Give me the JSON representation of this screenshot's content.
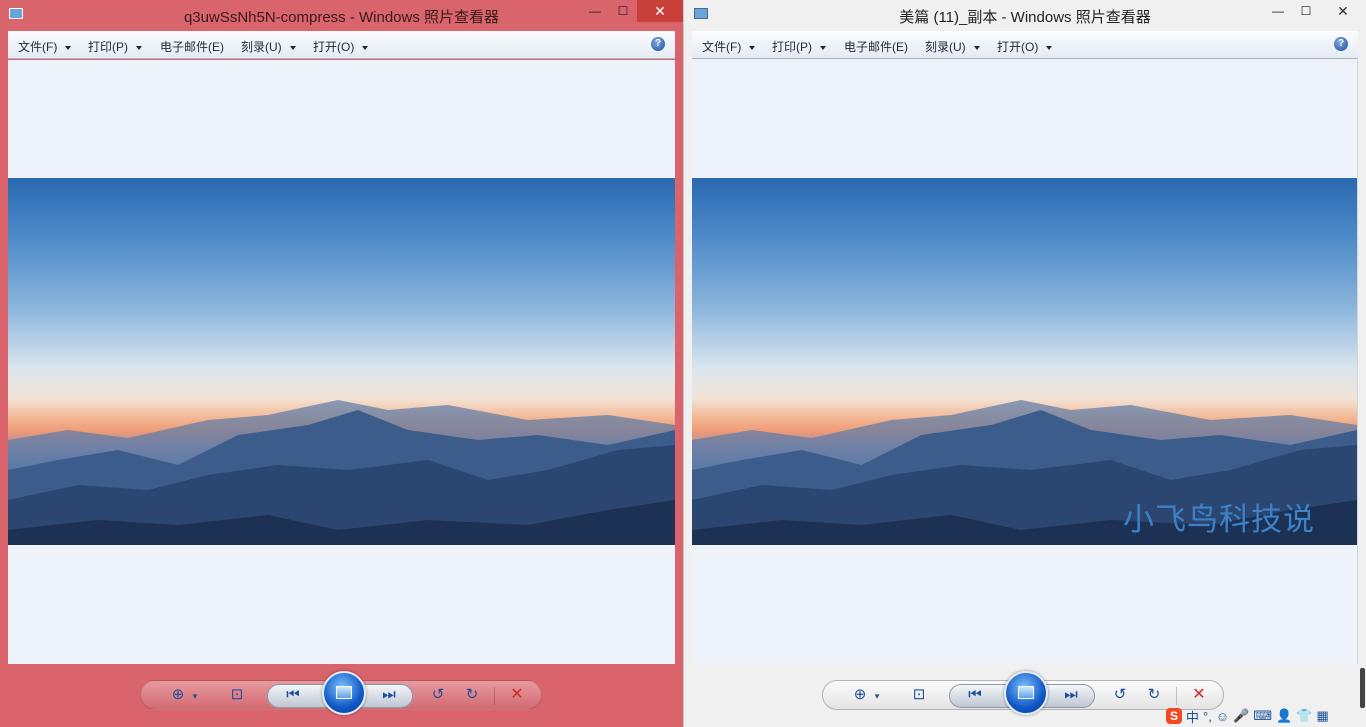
{
  "left_window": {
    "title": "q3uwSsNh5N-compress - Windows 照片查看器",
    "controls": {
      "minimize": "—",
      "maximize": "☐",
      "close": "✕"
    },
    "menu": [
      "文件(F)",
      "打印(P)",
      "电子邮件(E)",
      "刻录(U)",
      "打开(O)"
    ],
    "help": "?",
    "bar": {
      "zoom": "⊕",
      "fit": "⊡",
      "prev": "⏮",
      "next": "⏭",
      "rotate_ccw": "↺",
      "rotate_cw": "↻",
      "delete": "✕"
    }
  },
  "right_window": {
    "title": "美篇 (11)_副本 - Windows 照片查看器",
    "controls": {
      "minimize": "—",
      "maximize": "☐",
      "close": "✕"
    },
    "menu": [
      "文件(F)",
      "打印(P)",
      "电子邮件(E)",
      "刻录(U)",
      "打开(O)"
    ],
    "help": "?",
    "watermark": "小飞鸟科技说",
    "bar": {
      "zoom": "⊕",
      "fit": "⊡",
      "prev": "⏮",
      "next": "⏭",
      "rotate_ccw": "↺",
      "rotate_cw": "↻",
      "delete": "✕"
    }
  },
  "tray": [
    "S",
    "中",
    "°,",
    "☺",
    "🎤",
    "⌨",
    "👤",
    "👕",
    "▦"
  ],
  "colors": {
    "left_frame": "#d9646c",
    "right_frame": "#f0f0f0",
    "accent": "#1e4f9e",
    "delete": "#d02a2a"
  }
}
